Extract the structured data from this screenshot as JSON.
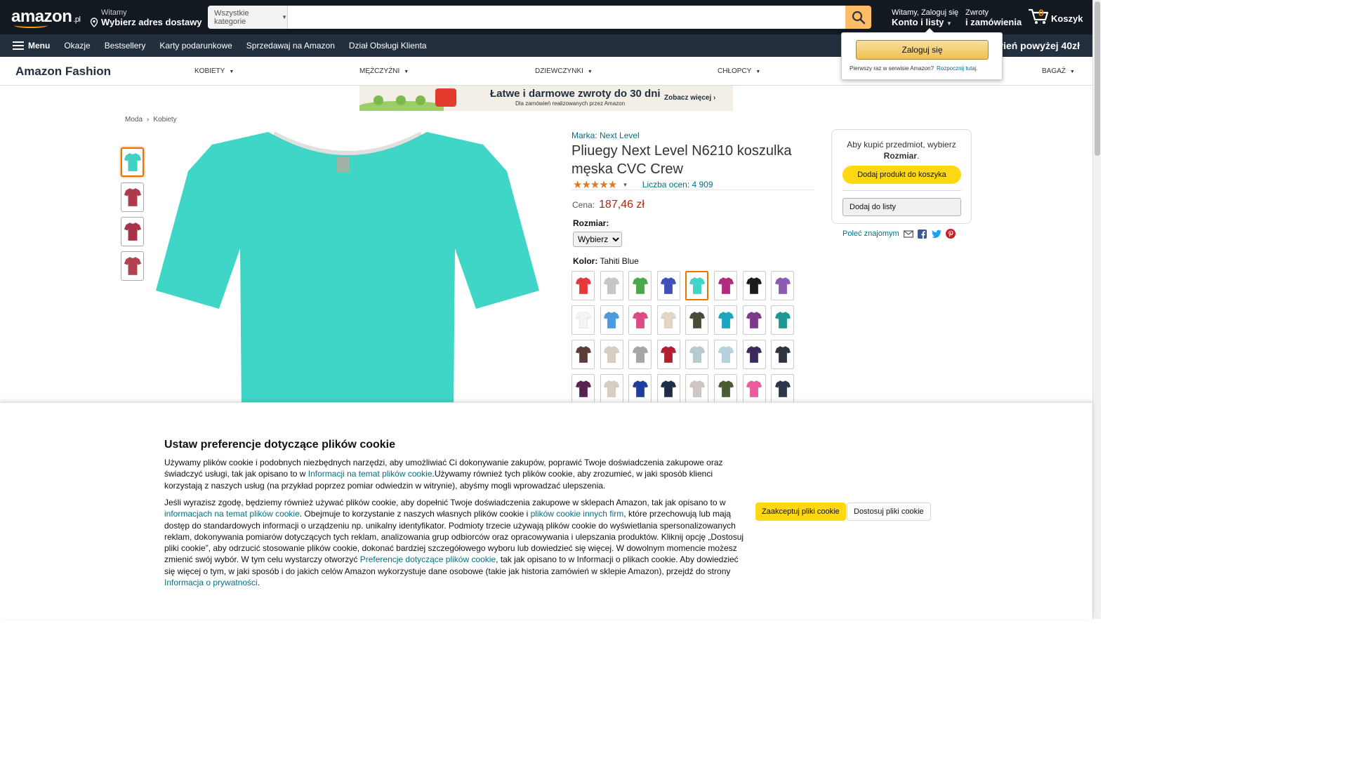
{
  "header": {
    "logo_text": "amazon",
    "logo_suffix": ".pl",
    "deliver_line1": "Witamy",
    "deliver_line2": "Wybierz adres dostawy",
    "search_category": "Wszystkie kategorie",
    "search_placeholder": "",
    "account_line1": "Witamy, Zaloguj się",
    "account_line2": "Konto i listy",
    "returns_line1": "Zwroty",
    "returns_line2": "i zamówienia",
    "cart_count": "0",
    "cart_label": "Koszyk"
  },
  "subnav": {
    "menu": "Menu",
    "items": [
      "Okazje",
      "Bestsellery",
      "Karty podarunkowe",
      "Sprzedawaj na Amazon",
      "Dział Obsługi Klienta"
    ],
    "promo": "owień powyżej 40zł"
  },
  "fashion": {
    "brand": "Amazon Fashion",
    "categories": [
      "KOBIETY",
      "MĘŻCZYŹNI",
      "DZIEWCZYNKI",
      "CHŁOPCY",
      "BAGAŻ"
    ]
  },
  "banner": {
    "headline": "Łatwe i darmowe zwroty do 30 dni",
    "subline": "Dla zamówień realizowanych przez Amazon",
    "cta": "Zobacz więcej ›"
  },
  "breadcrumb": [
    "Moda",
    "Kobiety"
  ],
  "product": {
    "brand": "Marka: Next Level",
    "title": "Pliuegy Next Level N6210 koszulka męska CVC Crew",
    "rating_count": "Liczba ocen: 4 909",
    "price_label": "Cena:",
    "price": "187,46 zł",
    "size_label": "Rozmiar:",
    "size_selected": "Wybierz",
    "color_label": "Kolor:",
    "color_value": "Tahiti Blue",
    "thumb_colors": [
      "#3ed3c6",
      "#b03a4a",
      "#a83248",
      "#b2424f"
    ],
    "main_color": "#3fd6c7",
    "swatches": [
      "#e8363b",
      "#c7c7c9",
      "#4aa84a",
      "#3f4fb8",
      "#3fd6c7",
      "#b02a7e",
      "#1b1b1d",
      "#8d5bb5",
      "#f4f4f4",
      "#4a9be0",
      "#e04a84",
      "#e3d7c4",
      "#4b4a36",
      "#1aa6c0",
      "#7d3a8d",
      "#1a9a92",
      "#5a3e35",
      "#d8cfc2",
      "#a6a6a6",
      "#b2202f",
      "#b7cbd3",
      "#b5d2de",
      "#3b2a5e",
      "#2c3440",
      "#5a2050",
      "#d8cfc2",
      "#1f3fa0",
      "#1f2e48",
      "#cfc5c2",
      "#4a5a33",
      "#ec5c9c",
      "#2b3648"
    ]
  },
  "buybox": {
    "msg_line1": "Aby kupić przedmiot, wybierz",
    "msg_bold": "Rozmiar",
    "add_to_cart": "Dodaj produkt do koszyka",
    "add_to_list": "Dodaj do listy",
    "share_label": "Poleć znajomym"
  },
  "flyout": {
    "signin": "Zaloguj się",
    "new_customer": "Pierwszy raz w serwisie Amazon?",
    "start_here": "Rozpocznij tutaj."
  },
  "cookie": {
    "title": "Ustaw preferencje dotyczące plików cookie",
    "p1_a": "Używamy plików cookie i podobnych niezbędnych narzędzi, aby umożliwiać Ci dokonywanie zakupów, poprawić Twoje doświadczenia zakupowe oraz świadczyć usługi, tak jak opisano to w ",
    "p1_link": "Informacji na temat plików cookie",
    "p1_b": ".Używamy również tych plików cookie, aby zrozumieć, w jaki sposób klienci korzystają z naszych usług (na przykład poprzez pomiar odwiedzin w witrynie), abyśmy mogli wprowadzać ulepszenia.",
    "p2_a": "Jeśli wyrazisz zgodę, będziemy również używać plików cookie, aby dopełnić Twoje doświadczenia zakupowe w sklepach Amazon, tak jak opisano to w ",
    "p2_link1": "informacjach na temat plików cookie",
    "p2_b": ". Obejmuje to korzystanie z naszych własnych plików cookie i ",
    "p2_link2": "plików cookie innych firm",
    "p2_c": ", które przechowują lub mają dostęp do standardowych informacji o urządzeniu np. unikalny identyfikator. Podmioty trzecie używają plików cookie do wyświetlania spersonalizowanych reklam, dokonywania pomiarów dotyczących tych reklam, analizowania grup odbiorców oraz opracowywania i ulepszania produktów. Kliknij opcję „Dostosuj pliki cookie”, aby odrzucić stosowanie plików cookie, dokonać bardziej szczegółowego wyboru lub dowiedzieć się więcej. W dowolnym momencie możesz zmienić swój wybór. W tym celu wystarczy otworzyć ",
    "p2_link3": "Preferencje dotyczące plików cookie",
    "p2_d": ", tak jak opisano to w Informacji o plikach cookie. Aby dowiedzieć się więcej o tym, w jaki sposób i do jakich celów Amazon wykorzystuje dane osobowe (takie jak historia zamówień w sklepie Amazon), przejdź do strony ",
    "p2_link4": "Informacja o prywatności",
    "p2_e": ".",
    "accept": "Zaakceptuj pliki cookie",
    "customize": "Dostosuj pliki cookie"
  }
}
